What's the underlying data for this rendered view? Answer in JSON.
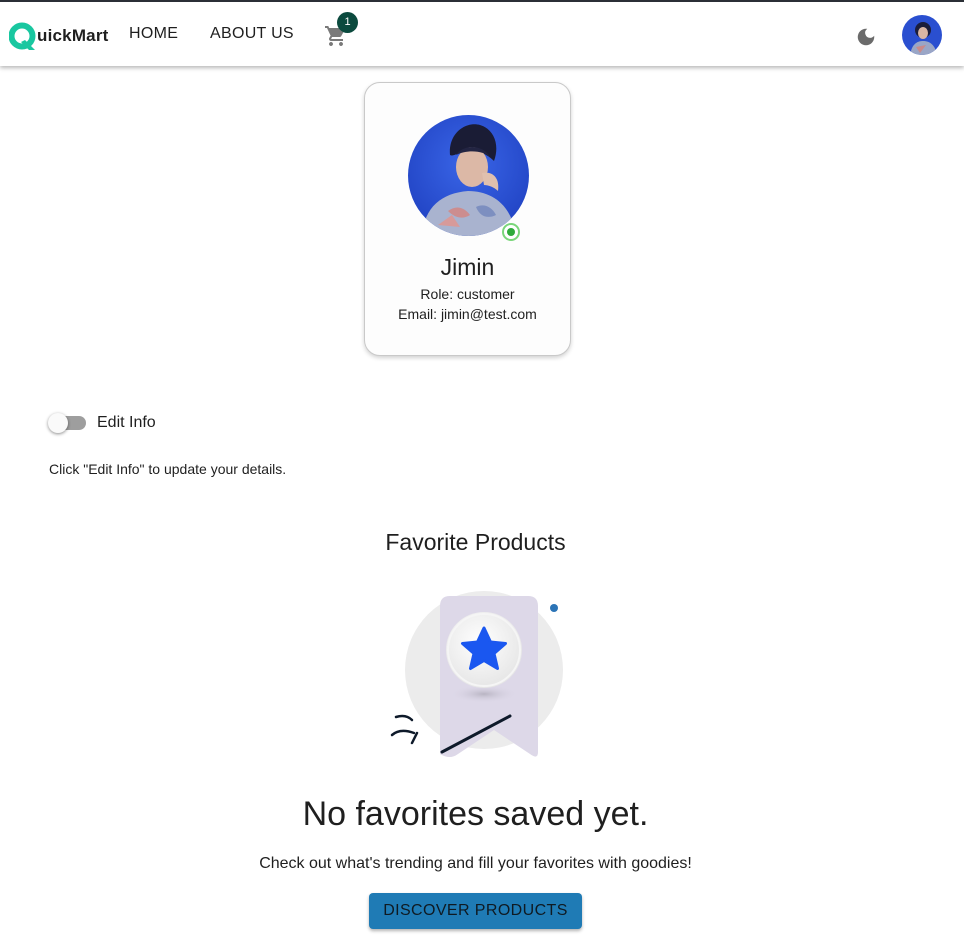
{
  "header": {
    "logo_text": "uickMart",
    "nav": [
      {
        "label": "HOME"
      },
      {
        "label": "ABOUT US"
      }
    ],
    "cart_count": "1",
    "icons": [
      "cart-icon",
      "moon-icon"
    ],
    "colors": {
      "brand": "#19c7a0",
      "badge": "#0b4a3e"
    }
  },
  "profile": {
    "name": "Jimin",
    "role": "Role: customer",
    "email": "Email: jimin@test.com",
    "status": "online"
  },
  "edit": {
    "label": "Edit Info",
    "enabled": false,
    "hint": "Click \"Edit Info\" to update your details."
  },
  "favorites": {
    "title": "Favorite Products",
    "empty_title": "No favorites saved yet.",
    "empty_subtitle": "Check out what's trending and fill your favorites with goodies!",
    "button": "DISCOVER PRODUCTS",
    "colors": {
      "button": "#1f7bb5",
      "star": "#1a57f0",
      "ribbon": "#ddd8e8"
    }
  }
}
